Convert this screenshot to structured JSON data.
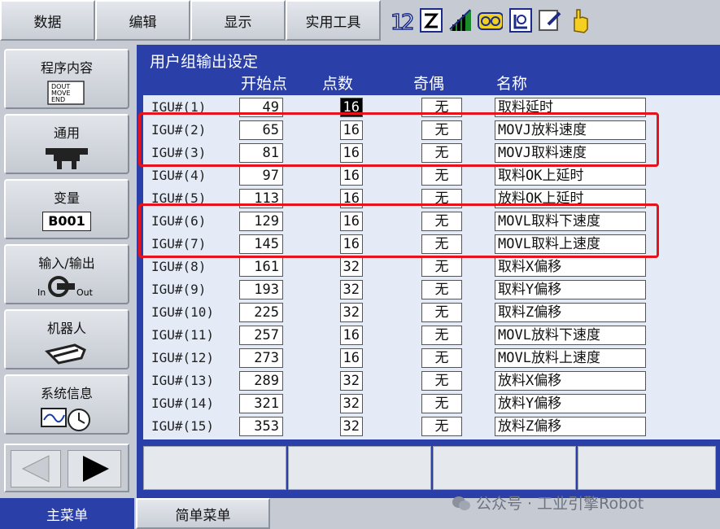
{
  "top_menu": [
    "数据",
    "编辑",
    "显示",
    "实用工具"
  ],
  "sidebar": [
    {
      "label": "程序内容",
      "icon": "program-doc-icon",
      "icon_text": "DOUT MOVE END"
    },
    {
      "label": "通用",
      "icon": "gripper-icon"
    },
    {
      "label": "变量",
      "icon": "variable-icon",
      "icon_text": "B001"
    },
    {
      "label": "输入/输出",
      "icon": "io-icon",
      "icon_text_in": "In",
      "icon_text_out": "Out"
    },
    {
      "label": "机器人",
      "icon": "robot-arm-icon"
    },
    {
      "label": "系统信息",
      "icon": "system-info-icon"
    }
  ],
  "screen": {
    "title": "用户组输出设定",
    "columns": [
      "开始点",
      "点数",
      "奇偶",
      "名称"
    ]
  },
  "rows": [
    {
      "label": "IGU#(1)",
      "start": "49",
      "points": "16",
      "parity": "无",
      "name": "取料延时",
      "selected": true
    },
    {
      "label": "IGU#(2)",
      "start": "65",
      "points": "16",
      "parity": "无",
      "name": "MOVJ放料速度"
    },
    {
      "label": "IGU#(3)",
      "start": "81",
      "points": "16",
      "parity": "无",
      "name": "MOVJ取料速度"
    },
    {
      "label": "IGU#(4)",
      "start": "97",
      "points": "16",
      "parity": "无",
      "name": "取料OK上延时"
    },
    {
      "label": "IGU#(5)",
      "start": "113",
      "points": "16",
      "parity": "无",
      "name": "放料OK上延时"
    },
    {
      "label": "IGU#(6)",
      "start": "129",
      "points": "16",
      "parity": "无",
      "name": "MOVL取料下速度"
    },
    {
      "label": "IGU#(7)",
      "start": "145",
      "points": "16",
      "parity": "无",
      "name": "MOVL取料上速度"
    },
    {
      "label": "IGU#(8)",
      "start": "161",
      "points": "32",
      "parity": "无",
      "name": "取料X偏移"
    },
    {
      "label": "IGU#(9)",
      "start": "193",
      "points": "32",
      "parity": "无",
      "name": "取料Y偏移"
    },
    {
      "label": "IGU#(10)",
      "start": "225",
      "points": "32",
      "parity": "无",
      "name": "取料Z偏移"
    },
    {
      "label": "IGU#(11)",
      "start": "257",
      "points": "16",
      "parity": "无",
      "name": "MOVL放料下速度"
    },
    {
      "label": "IGU#(12)",
      "start": "273",
      "points": "16",
      "parity": "无",
      "name": "MOVL放料上速度"
    },
    {
      "label": "IGU#(13)",
      "start": "289",
      "points": "32",
      "parity": "无",
      "name": "放料X偏移"
    },
    {
      "label": "IGU#(14)",
      "start": "321",
      "points": "32",
      "parity": "无",
      "name": "放料Y偏移"
    },
    {
      "label": "IGU#(15)",
      "start": "353",
      "points": "32",
      "parity": "无",
      "name": "放料Z偏移"
    }
  ],
  "tabs": [
    "主菜单",
    "简单菜单"
  ],
  "watermark": "公众号 · 工业引擎Robot",
  "colors": {
    "screen_bg": "#2a3fa8",
    "panel_bg": "#e4ebf7",
    "highlight": "#e8121a",
    "active_tab": "#2a3fa8"
  }
}
